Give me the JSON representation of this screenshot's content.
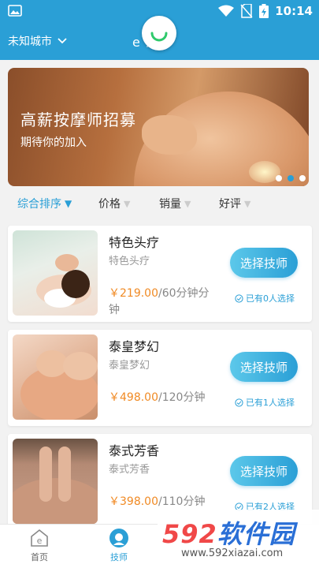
{
  "status_bar": {
    "time": "10:14",
    "icons": [
      "image-icon",
      "wifi-icon",
      "no-sim-icon",
      "battery-charging-icon"
    ]
  },
  "header": {
    "city": "未知城市",
    "title": "e    家"
  },
  "banner": {
    "title": "高薪按摩师招募",
    "subtitle": "期待你的加入",
    "dots": 3,
    "active_dot": 2
  },
  "sort_bar": {
    "items": [
      {
        "label": "综合排序",
        "active": true
      },
      {
        "label": "价格",
        "active": false
      },
      {
        "label": "销量",
        "active": false
      },
      {
        "label": "好评",
        "active": false
      }
    ]
  },
  "services": [
    {
      "name": "特色头疗",
      "subtitle": "特色头疗",
      "price": "￥219.00",
      "unit": "/60分钟分钟",
      "button": "选择技师",
      "selected": "已有0人选择"
    },
    {
      "name": "泰皇梦幻",
      "subtitle": "泰皇梦幻",
      "price": "￥498.00",
      "unit": "/120分钟",
      "button": "选择技师",
      "selected": "已有1人选择"
    },
    {
      "name": "泰式芳香",
      "subtitle": "泰式芳香",
      "price": "￥398.00",
      "unit": "/110分钟",
      "button": "选择技师",
      "selected": "已有2人选择"
    }
  ],
  "bottom_nav": {
    "items": [
      {
        "label": "首页",
        "icon": "home-icon",
        "active": false
      },
      {
        "label": "技师",
        "icon": "technician-icon",
        "active": true
      }
    ]
  },
  "watermark": {
    "logo_num": "592",
    "logo_text": "软件园",
    "url": "www.592xiazai.com"
  },
  "colors": {
    "primary": "#2a9fd6",
    "price": "#f08a24"
  }
}
